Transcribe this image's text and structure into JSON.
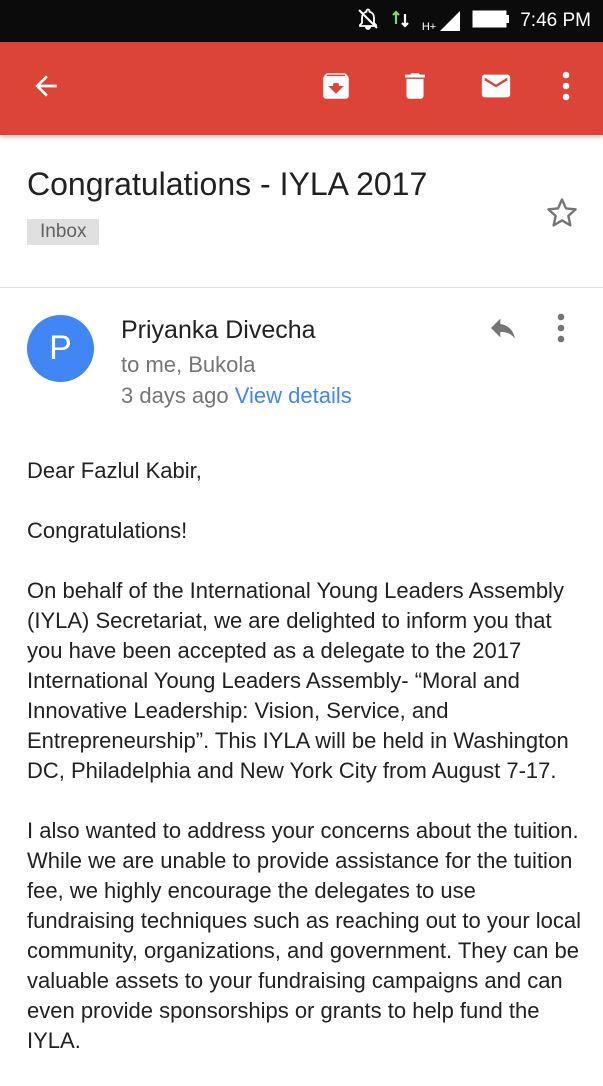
{
  "status_bar": {
    "time": "7:46 PM",
    "network": "H+"
  },
  "app_bar": {
    "icons": [
      "back-arrow-icon",
      "archive-icon",
      "delete-icon",
      "mark-unread-icon",
      "more-vert-icon"
    ]
  },
  "email": {
    "subject": "Congratulations - IYLA 2017",
    "label": "Inbox",
    "sender": {
      "initial": "P",
      "name": "Priyanka Divecha",
      "recipients": "to me, Bukola",
      "time": "3 days ago",
      "details_link": "View details"
    },
    "body": {
      "greeting": "Dear Fazlul Kabir,",
      "p1": "Congratulations!",
      "p2": "On behalf of the International Young Leaders Assembly (IYLA) Secretariat, we are delighted to inform you that you have been accepted as a delegate to the 2017 International Young Leaders Assembly- “Moral and Innovative Leadership: Vision, Service, and Entrepreneurship”. This IYLA will be held in Washington DC, Philadelphia and New York City from August 7-17.",
      "p3": "I also wanted to address your concerns about the tuition. While we are unable to provide assistance for the tuition fee, we highly encourage the delegates to use fundraising techniques such as reaching out to your local community, organizations, and government. They can be valuable assets to your fundraising campaigns and can even provide sponsorships or grants to help fund the IYLA."
    }
  },
  "colors": {
    "app_bar": "#db4437",
    "avatar": "#4285f4",
    "link": "#4285f4",
    "status_bar": "#0b0b0b"
  }
}
